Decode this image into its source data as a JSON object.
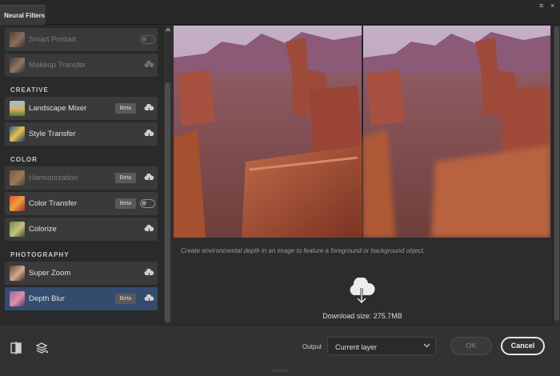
{
  "tab": {
    "title": "Neural Filters"
  },
  "window_controls": {
    "menu": "≡",
    "close": "×"
  },
  "sidebar": {
    "sections": [
      "CREATIVE",
      "COLOR",
      "PHOTOGRAPHY"
    ],
    "items": [
      {
        "label": "Smart Portrait",
        "control": "toggle",
        "dim": true,
        "icon": "portrait-thumbnail"
      },
      {
        "label": "Makeup Transfer",
        "control": "cloud",
        "dim": true,
        "icon": "portrait-thumbnail"
      },
      {
        "label": "Landscape Mixer",
        "badge": "Beta",
        "control": "cloud",
        "icon": "landscape-thumbnail"
      },
      {
        "label": "Style Transfer",
        "control": "cloud",
        "icon": "style-thumbnail"
      },
      {
        "label": "Harmonization",
        "badge": "Beta",
        "control": "cloud",
        "dim": true,
        "icon": "harmonization-thumbnail"
      },
      {
        "label": "Color Transfer",
        "badge": "Beta",
        "control": "toggle",
        "icon": "color-thumbnail"
      },
      {
        "label": "Colorize",
        "control": "cloud",
        "icon": "colorize-thumbnail"
      },
      {
        "label": "Super Zoom",
        "control": "cloud",
        "icon": "portrait-thumbnail"
      },
      {
        "label": "Depth Blur",
        "badge": "Beta",
        "control": "cloud",
        "selected": true,
        "icon": "depth-thumbnail"
      }
    ]
  },
  "preview": {
    "caption": "Create environmental depth in an image to feature a foreground or background object.",
    "download_text": "Download size: 275.7MB"
  },
  "bottom": {
    "output_label": "Output",
    "output_value": "Current layer",
    "ok_label": "OK",
    "cancel_label": "Cancel"
  },
  "colors": {
    "accent_selected": "#334c6e",
    "panel": "#3a3a3a"
  }
}
